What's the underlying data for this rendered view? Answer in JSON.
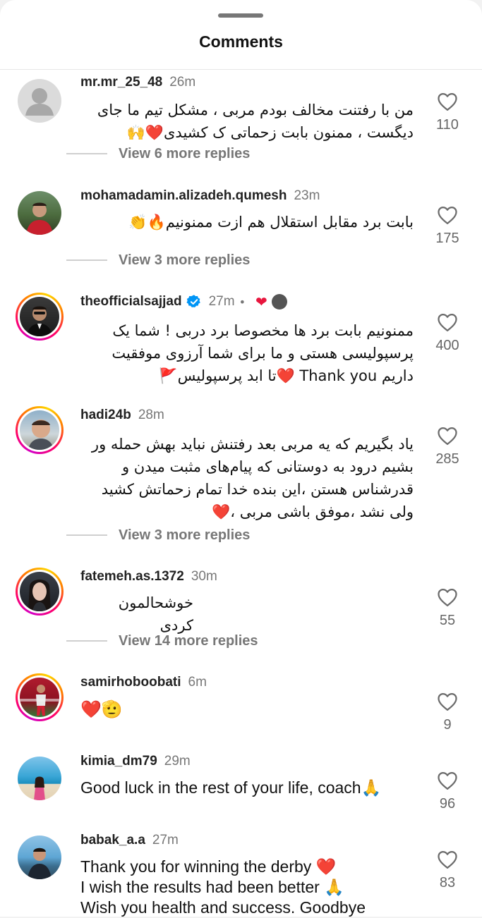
{
  "header": {
    "title": "Comments"
  },
  "comments": [
    {
      "username": "mr.mr_25_48",
      "time": "26m",
      "text_lines": [
        "من با رفتنت مخالف بودم مربی ، مشکل تیم ما جای",
        "دیگست ، ممنون بابت زحماتی ک کشیدی❤️🙌"
      ],
      "likes": "110",
      "replies": "View 6 more replies"
    },
    {
      "username": "mohamadamin.alizadeh.qumesh",
      "time": "23m",
      "text_lines": [
        "بابت برد مقابل استقلال هم ازت ممنونیم🔥👏"
      ],
      "likes": "175",
      "replies": "View 3 more replies"
    },
    {
      "username": "theofficialsajjad",
      "time": "27m",
      "dot": "•",
      "mini_heart": "❤",
      "text_lines": [
        "ممنونیم بابت برد ها مخصوصا برد دربی ! شما یک",
        "پرسپولیسی هستی و ما برای شما آرزوی موفقیت",
        "داریم  Thank you ❤️تا ابد پرسپولیس🚩"
      ],
      "likes": "400"
    },
    {
      "username": "hadi24b",
      "time": "28m",
      "text_lines": [
        "یاد بگیریم که یه مربی بعد رفتنش نباید بهش حمله ور",
        "بشیم درود به دوستانی که پیام‌های مثبت میدن و",
        "قدرشناس هستن ،این بنده خدا تمام زحماتش کشید",
        "ولی نشد ،موفق باشی مربی ،❤️"
      ],
      "likes": "285",
      "replies": "View 3 more replies"
    },
    {
      "username": "fatemeh.as.1372",
      "time": "30m",
      "text_lines": [
        "خوشحالمون کردی"
      ],
      "likes": "55",
      "replies": "View 14 more replies"
    },
    {
      "username": "samirhoboobati",
      "time": "6m",
      "text_lines": [
        "❤️🫡"
      ],
      "likes": "9"
    },
    {
      "username": "kimia_dm79",
      "time": "29m",
      "text_lines": [
        "Good luck in the rest of your life, coach🙏"
      ],
      "likes": "96"
    },
    {
      "username": "babak_a.a",
      "time": "27m",
      "text_lines": [
        "Thank you for winning the derby ❤️",
        "I wish the results had been better 🙏",
        "Wish you health and success. Goodbye"
      ],
      "likes": "83"
    }
  ],
  "colors": {
    "story_ring_start": "#d300c5",
    "story_ring_end": "#ffd600",
    "verified": "#0095f6",
    "muted": "#777777"
  }
}
